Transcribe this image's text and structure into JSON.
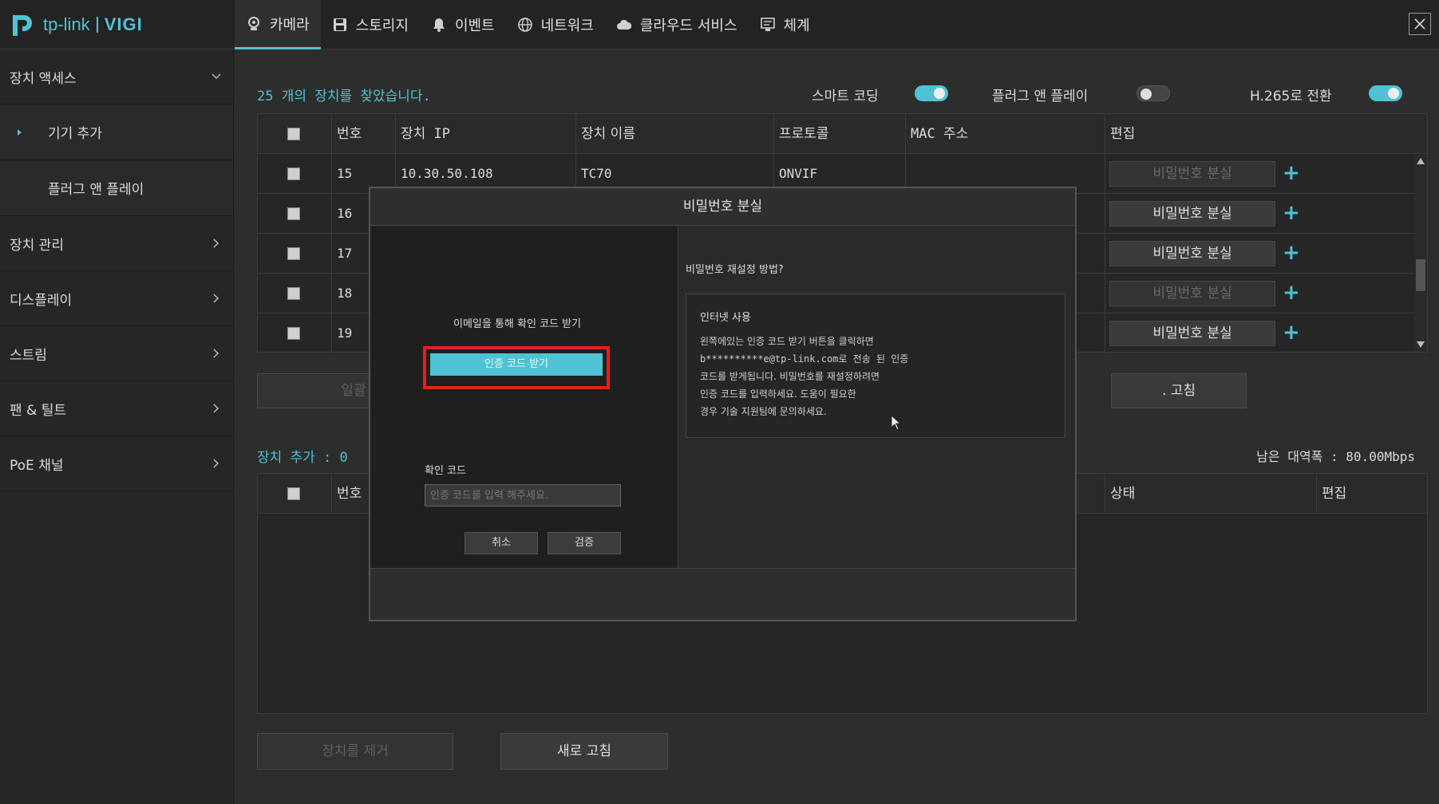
{
  "brand": {
    "tp": "tp-link",
    "vigi": "VIGI"
  },
  "tabs": [
    {
      "label": "카메라",
      "icon": "camera-icon",
      "active": true
    },
    {
      "label": "스토리지",
      "icon": "storage-icon",
      "active": false
    },
    {
      "label": "이벤트",
      "icon": "bell-icon",
      "active": false
    },
    {
      "label": "네트워크",
      "icon": "globe-icon",
      "active": false
    },
    {
      "label": "클라우드 서비스",
      "icon": "cloud-icon",
      "active": false
    },
    {
      "label": "체계",
      "icon": "system-icon",
      "active": false
    }
  ],
  "sidebar": {
    "items": [
      {
        "label": "장치 액세스",
        "chevron": "down"
      },
      {
        "label": "기기 추가",
        "sub": true,
        "active": true
      },
      {
        "label": "플러그 앤 플레이",
        "sub": true
      },
      {
        "label": "장치 관리",
        "chevron": "right"
      },
      {
        "label": "디스플레이",
        "chevron": "right"
      },
      {
        "label": "스트림",
        "chevron": "right"
      },
      {
        "label": "팬 & 틸트",
        "chevron": "right"
      },
      {
        "label": "PoE 채널",
        "chevron": "right"
      }
    ]
  },
  "found": "25 개의 장치를 찾았습니다.",
  "toggles": {
    "smart_coding": {
      "label": "스마트 코딩",
      "on": true
    },
    "plug_play": {
      "label": "플러그 앤 플레이",
      "on": false
    },
    "h265": {
      "label": "H.265로 전환",
      "on": true
    }
  },
  "device_table": {
    "headers": [
      "번호",
      "장치 IP",
      "장치 이름",
      "프로토콜",
      "MAC 주소",
      "편집"
    ],
    "rows": [
      {
        "no": "15",
        "ip": "10.30.50.108",
        "name": "TC70",
        "protocol": "ONVIF",
        "mac": "",
        "btn": "비밀번호 분실",
        "dim": true
      },
      {
        "no": "16",
        "ip": "",
        "name": "",
        "protocol": "",
        "mac": "",
        "btn": "비밀번호 분실",
        "dim": false
      },
      {
        "no": "17",
        "ip": "",
        "name": "",
        "protocol": "",
        "mac": "",
        "btn": "비밀번호 분실",
        "dim": false
      },
      {
        "no": "18",
        "ip": "",
        "name": "",
        "protocol": "",
        "mac": "",
        "btn": "비밀번호 분실",
        "dim": true
      },
      {
        "no": "19",
        "ip": "",
        "name": "",
        "protocol": "",
        "mac": "",
        "btn": "비밀번호 분실",
        "dim": false
      }
    ]
  },
  "buttons": {
    "batch_add": "일괄",
    "refresh_partial": ". 고침",
    "remove": "장치를 제거",
    "refresh": "새로 고침"
  },
  "added": {
    "label": "장치 추가 : 0",
    "bandwidth": "남은 대역폭 : 80.00Mbps",
    "headers": [
      "번호",
      "상태",
      "편집"
    ]
  },
  "modal": {
    "title": "비밀번호 분실",
    "email_prompt": "이메일을 통해 확인 코드 받기",
    "get_code": "인증 코드 받기",
    "code_label": "확인 코드",
    "code_placeholder": "인증 코드를 입력 해주세요.",
    "cancel": "취소",
    "verify": "검증",
    "how_title": "비밀번호 재설정 방법?",
    "info_title": "인터넷 사용",
    "info_lines": [
      "왼쪽에있는 인증 코드 받기 버튼을 클릭하면",
      "b**********e@tp-link.com로 전송 된 인증",
      "코드를 받게됩니다. 비밀번호를 재설정하려면",
      "인증 코드를 입력하세요. 도움이 필요한",
      "경우 기술 지원팀에 문의하세요."
    ]
  },
  "colors": {
    "accent": "#4fc3d5",
    "highlight": "#e02020"
  }
}
